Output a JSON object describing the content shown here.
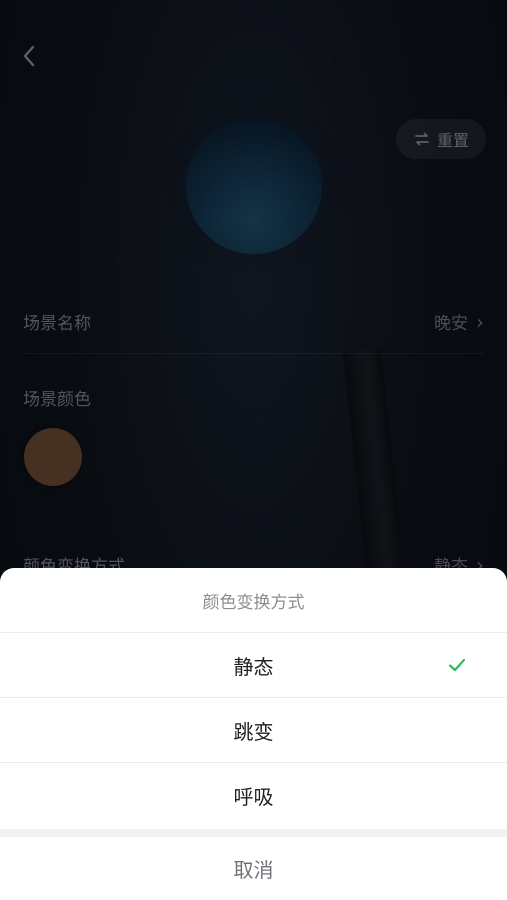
{
  "header": {
    "back_icon": "chevron-left-icon",
    "reset_label": "重置",
    "reset_icon": "refresh-icon"
  },
  "scene": {
    "name_label": "场景名称",
    "name_value": "晚安",
    "color_label": "场景颜色",
    "color_swatch": "#6b4a35",
    "mode_label": "颜色变换方式",
    "mode_value": "静态"
  },
  "sheet": {
    "title": "颜色变换方式",
    "options": [
      {
        "label": "静态",
        "selected": true
      },
      {
        "label": "跳变",
        "selected": false
      },
      {
        "label": "呼吸",
        "selected": false
      }
    ],
    "cancel_label": "取消",
    "check_color": "#2dbb5a"
  }
}
